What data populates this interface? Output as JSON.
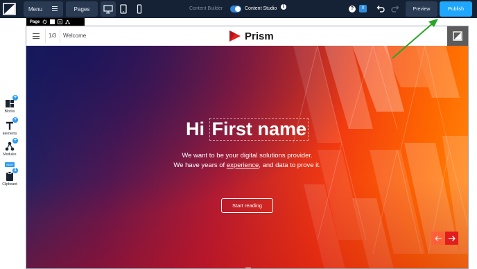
{
  "toolbar": {
    "menu_label": "Menu",
    "pages_label": "Pages",
    "content_builder_label": "Content Builder",
    "content_studio_label": "Content Studio",
    "content_studio_enabled": true,
    "notification_count": "0",
    "preview_label": "Preview",
    "publish_label": "Publish",
    "device_active": "desktop"
  },
  "sidebar": {
    "items": [
      {
        "label": "Blocks",
        "icon": "blocks-icon"
      },
      {
        "label": "Elements",
        "icon": "elements-icon"
      },
      {
        "label": "Modules",
        "icon": "modules-icon",
        "badge": "NEW"
      },
      {
        "label": "Clipboard",
        "icon": "clipboard-icon",
        "count": "1"
      }
    ]
  },
  "page_bar": {
    "label": "Page"
  },
  "site": {
    "counter": "1/3",
    "nav_label": "Welcome",
    "brand_name": "Prism"
  },
  "hero": {
    "greeting": "Hi",
    "name_placeholder": "First name",
    "line1": "We want to be your digital solutions provider.",
    "line2_before": "We have years of ",
    "line2_link": "experience",
    "line2_after": ", and data to prove it.",
    "cta_label": "Start reading"
  },
  "colors": {
    "toolbar_bg": "#152235",
    "accent_blue": "#1ea7fd",
    "brand_red": "#e31c1c",
    "annotation_green": "#2aa52a"
  }
}
